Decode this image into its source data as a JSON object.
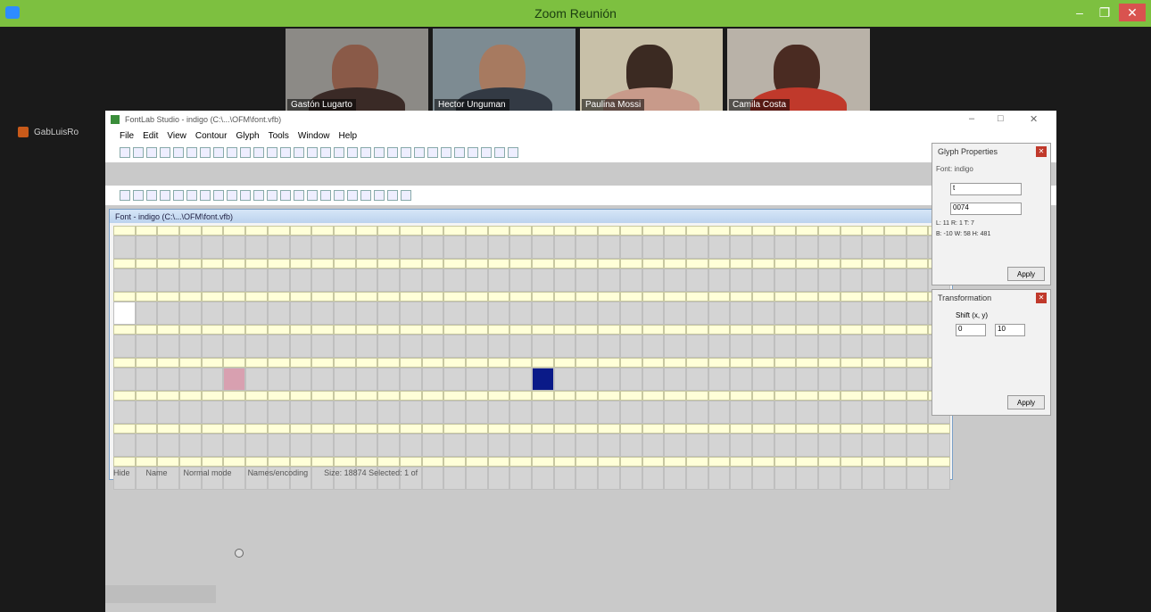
{
  "zoom": {
    "window_title": "Zoom Reunión",
    "controls": {
      "minimize": "–",
      "maximize": "❐",
      "close": "✕"
    },
    "participants": [
      {
        "name": "Gastón Lugarto"
      },
      {
        "name": "Hector Unguman"
      },
      {
        "name": "Paulina Mossi"
      },
      {
        "name": "Camila Costa"
      }
    ],
    "sharing_user": "GabLuisRo"
  },
  "fontstudio": {
    "app_title": "FontLab Studio - indigo (C:\\...\\OFM\\font.vfb)",
    "menu": [
      "File",
      "Edit",
      "View",
      "Contour",
      "Glyph",
      "Tools",
      "Window",
      "Help"
    ],
    "font_window_title": "Font - indigo (C:\\...\\OFM\\font.vfb)",
    "status_left": "Hide",
    "status_mid1": "Name",
    "status_mid2": "Normal mode",
    "status_mid3": "Names/encoding",
    "status_right": "Size: 18874  Selected: 1 of"
  },
  "grid": {
    "rows": [
      {
        "cells": [
          "",
          "",
          "",
          "",
          "",
          "",
          "",
          "",
          "",
          "",
          "",
          "",
          "",
          "",
          "",
          "",
          "",
          "",
          "",
          "",
          "",
          "",
          "",
          "",
          "",
          "",
          "",
          "",
          "",
          "",
          "",
          "",
          "",
          "",
          "",
          "",
          "",
          ""
        ]
      },
      {
        "cells": [
          "",
          "",
          "",
          "",
          "",
          "",
          "",
          "",
          "",
          "",
          "",
          "",
          "",
          "",
          "",
          "",
          "",
          "",
          "",
          "",
          "",
          "",
          "",
          "",
          "",
          "",
          "",
          "",
          "",
          "",
          "",
          "",
          "",
          "",
          "",
          "",
          "",
          ""
        ]
      },
      {
        "cells": [
          "",
          "",
          "",
          "",
          "",
          "",
          "",
          "",
          "",
          "",
          "",
          "",
          "",
          "",
          "",
          "",
          "",
          "",
          "",
          "",
          "",
          "",
          "",
          "",
          "",
          "",
          "",
          "",
          "",
          "",
          "",
          "",
          "",
          "",
          "",
          "",
          "",
          ""
        ]
      },
      {
        "cells": [
          "",
          "",
          "",
          "",
          "",
          "",
          "",
          "",
          "",
          "",
          "",
          "",
          "",
          "",
          "",
          "",
          "",
          "",
          "",
          "",
          "",
          "",
          "",
          "",
          "",
          "",
          "",
          "",
          "",
          "",
          "",
          "",
          "",
          "",
          "",
          "",
          "",
          ""
        ]
      },
      {
        "cells": [
          "",
          "",
          "",
          "",
          "",
          "",
          "",
          "",
          "",
          "",
          "",
          "",
          "",
          "",
          "",
          "",
          "",
          "",
          "",
          "",
          "",
          "",
          "",
          "",
          "",
          "",
          "",
          "",
          "",
          "",
          "",
          "",
          "",
          "",
          "",
          "",
          "",
          ""
        ]
      },
      {
        "cells": [
          "",
          "",
          "",
          "",
          "",
          "",
          "",
          "",
          "",
          "",
          "",
          "",
          "",
          "",
          "",
          "",
          "",
          "",
          "",
          "",
          "",
          "",
          "",
          "",
          "",
          "",
          "",
          "",
          "",
          "",
          "",
          "",
          "",
          "",
          "",
          "",
          "",
          ""
        ]
      },
      {
        "cells": [
          "",
          "",
          "",
          "",
          "",
          "",
          "",
          "",
          "",
          "",
          "",
          "",
          "",
          "",
          "",
          "",
          "",
          "",
          "",
          "",
          "",
          "",
          "",
          "",
          "",
          "",
          "",
          "",
          "",
          "",
          "",
          "",
          "",
          "",
          "",
          "",
          "",
          ""
        ]
      },
      {
        "cells": [
          "",
          "",
          "",
          "",
          "",
          "",
          "",
          "",
          "",
          "",
          "",
          "",
          "",
          "",
          "",
          "",
          "",
          "",
          "",
          "",
          "",
          "",
          "",
          "",
          "",
          "",
          "",
          "",
          "",
          "",
          "",
          "",
          "",
          "",
          "",
          "",
          "",
          ""
        ]
      }
    ]
  },
  "glyph_properties": {
    "title": "Glyph Properties",
    "font": "Font: indigo",
    "unicode_value": "t",
    "code_value": "0074",
    "metrics": [
      "L: 11    R: 1    T: 7",
      "B: -10   W: 58   H: 481"
    ],
    "apply": "Apply"
  },
  "transformation": {
    "title": "Transformation",
    "label": "Shift (x, y)",
    "x_value": "0",
    "y_value": "10",
    "apply": "Apply"
  }
}
